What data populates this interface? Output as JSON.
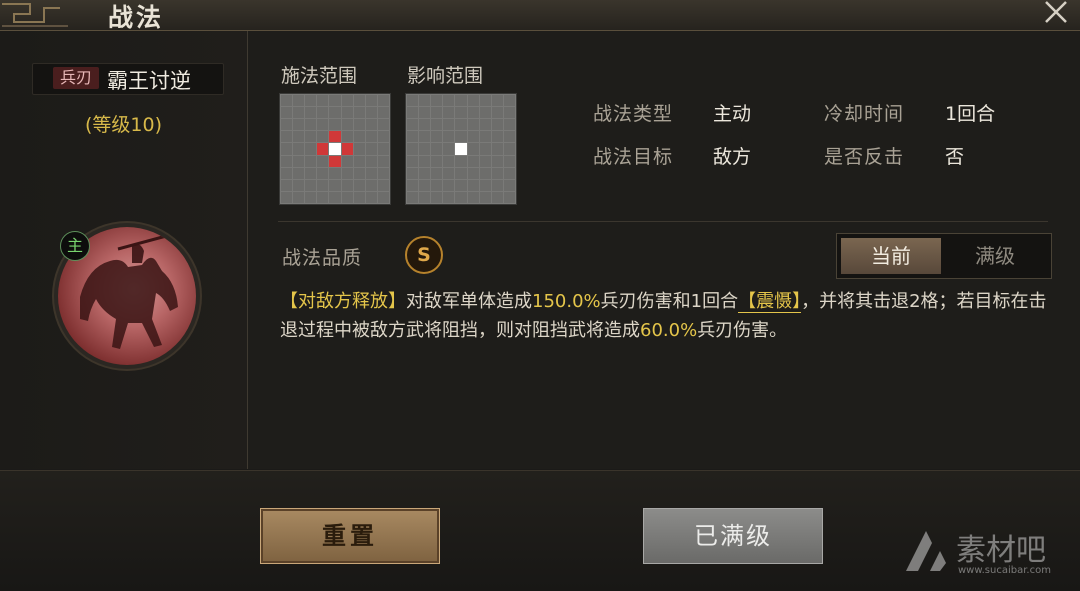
{
  "window": {
    "title": "战法",
    "close_icon": "close-icon"
  },
  "skill": {
    "type_badge": "兵刃",
    "name": "霸王讨逆",
    "level": "(等级10)",
    "role_badge": "主",
    "portrait_icon": "general-on-horse-portrait"
  },
  "range": {
    "cast_label": "施法范围",
    "effect_label": "影响范围",
    "grid_size": 9
  },
  "info": {
    "type_label": "战法类型",
    "type_value": "主动",
    "cooldown_label": "冷却时间",
    "cooldown_value": "1回合",
    "target_label": "战法目标",
    "target_value": "敌方",
    "counter_label": "是否反击",
    "counter_value": "否"
  },
  "quality": {
    "label": "战法品质",
    "value": "S"
  },
  "toggle": {
    "current": "当前",
    "max": "满级"
  },
  "description": {
    "p1": "【对敌方释放】",
    "p2": "对敌军单体造成",
    "p3": "150.0%",
    "p4": "兵刃伤害和1回合",
    "p5": "【震慑】",
    "p6": "，并将其击退2格；若目标在击退过程中被敌方武将阻挡，则对阻挡武将造成",
    "p7": "60.0%",
    "p8": "兵刃伤害。"
  },
  "buttons": {
    "reset": "重置",
    "maxed": "已满级"
  },
  "watermark": {
    "text": "素材吧",
    "url": "www.sucaibar.com"
  },
  "colors": {
    "accent_gold": "#e4c54a",
    "range_red": "#d03838",
    "role_green": "#79d36e"
  }
}
